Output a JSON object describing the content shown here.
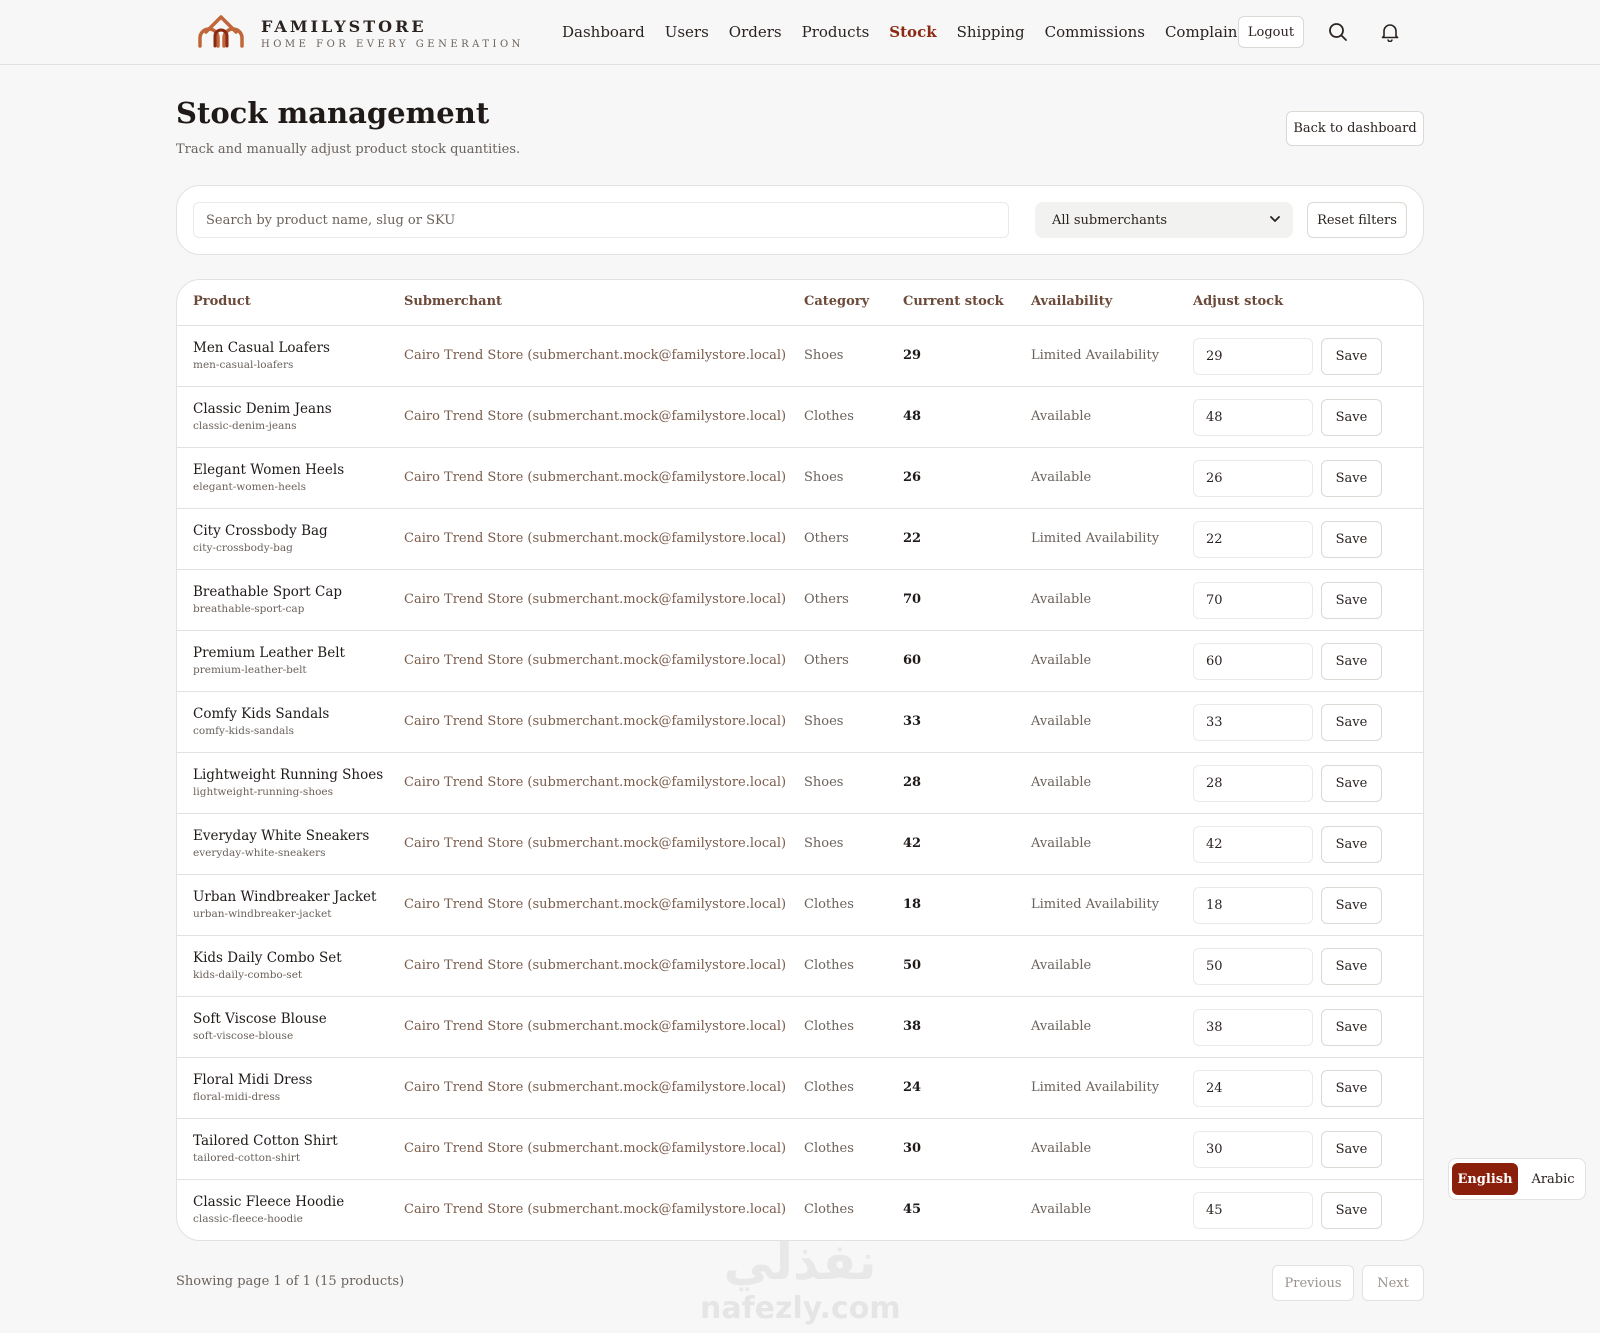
{
  "brand": {
    "name": "FAMILYSTORE",
    "tagline": "HOME FOR EVERY GENERATION"
  },
  "nav": {
    "items": [
      "Dashboard",
      "Users",
      "Orders",
      "Products",
      "Stock",
      "Shipping",
      "Commissions",
      "Complaints"
    ],
    "active": "Stock",
    "logout_label": "Logout"
  },
  "colors": {
    "accent": "#8a2a12",
    "lang_active_bg": "#8a1f0c"
  },
  "page": {
    "title": "Stock management",
    "subtitle": "Track and manually adjust product stock quantities.",
    "back_label": "Back to dashboard"
  },
  "filters": {
    "search_placeholder": "Search by product name, slug or SKU",
    "submerchant_selected": "All submerchants",
    "reset_label": "Reset filters"
  },
  "table": {
    "headers": [
      "Product",
      "Submerchant",
      "Category",
      "Current stock",
      "Availability",
      "Adjust stock"
    ],
    "save_label": "Save",
    "rows": [
      {
        "name": "Men Casual Loafers",
        "slug": "men-casual-loafers",
        "submerchant": "Cairo Trend Store (submerchant.mock@familystore.local)",
        "category": "Shoes",
        "stock": "29",
        "availability": "Limited Availability",
        "adjust": "29"
      },
      {
        "name": "Classic Denim Jeans",
        "slug": "classic-denim-jeans",
        "submerchant": "Cairo Trend Store (submerchant.mock@familystore.local)",
        "category": "Clothes",
        "stock": "48",
        "availability": "Available",
        "adjust": "48"
      },
      {
        "name": "Elegant Women Heels",
        "slug": "elegant-women-heels",
        "submerchant": "Cairo Trend Store (submerchant.mock@familystore.local)",
        "category": "Shoes",
        "stock": "26",
        "availability": "Available",
        "adjust": "26"
      },
      {
        "name": "City Crossbody Bag",
        "slug": "city-crossbody-bag",
        "submerchant": "Cairo Trend Store (submerchant.mock@familystore.local)",
        "category": "Others",
        "stock": "22",
        "availability": "Limited Availability",
        "adjust": "22"
      },
      {
        "name": "Breathable Sport Cap",
        "slug": "breathable-sport-cap",
        "submerchant": "Cairo Trend Store (submerchant.mock@familystore.local)",
        "category": "Others",
        "stock": "70",
        "availability": "Available",
        "adjust": "70"
      },
      {
        "name": "Premium Leather Belt",
        "slug": "premium-leather-belt",
        "submerchant": "Cairo Trend Store (submerchant.mock@familystore.local)",
        "category": "Others",
        "stock": "60",
        "availability": "Available",
        "adjust": "60"
      },
      {
        "name": "Comfy Kids Sandals",
        "slug": "comfy-kids-sandals",
        "submerchant": "Cairo Trend Store (submerchant.mock@familystore.local)",
        "category": "Shoes",
        "stock": "33",
        "availability": "Available",
        "adjust": "33"
      },
      {
        "name": "Lightweight Running Shoes",
        "slug": "lightweight-running-shoes",
        "submerchant": "Cairo Trend Store (submerchant.mock@familystore.local)",
        "category": "Shoes",
        "stock": "28",
        "availability": "Available",
        "adjust": "28"
      },
      {
        "name": "Everyday White Sneakers",
        "slug": "everyday-white-sneakers",
        "submerchant": "Cairo Trend Store (submerchant.mock@familystore.local)",
        "category": "Shoes",
        "stock": "42",
        "availability": "Available",
        "adjust": "42"
      },
      {
        "name": "Urban Windbreaker Jacket",
        "slug": "urban-windbreaker-jacket",
        "submerchant": "Cairo Trend Store (submerchant.mock@familystore.local)",
        "category": "Clothes",
        "stock": "18",
        "availability": "Limited Availability",
        "adjust": "18"
      },
      {
        "name": "Kids Daily Combo Set",
        "slug": "kids-daily-combo-set",
        "submerchant": "Cairo Trend Store (submerchant.mock@familystore.local)",
        "category": "Clothes",
        "stock": "50",
        "availability": "Available",
        "adjust": "50"
      },
      {
        "name": "Soft Viscose Blouse",
        "slug": "soft-viscose-blouse",
        "submerchant": "Cairo Trend Store (submerchant.mock@familystore.local)",
        "category": "Clothes",
        "stock": "38",
        "availability": "Available",
        "adjust": "38"
      },
      {
        "name": "Floral Midi Dress",
        "slug": "floral-midi-dress",
        "submerchant": "Cairo Trend Store (submerchant.mock@familystore.local)",
        "category": "Clothes",
        "stock": "24",
        "availability": "Limited Availability",
        "adjust": "24"
      },
      {
        "name": "Tailored Cotton Shirt",
        "slug": "tailored-cotton-shirt",
        "submerchant": "Cairo Trend Store (submerchant.mock@familystore.local)",
        "category": "Clothes",
        "stock": "30",
        "availability": "Available",
        "adjust": "30"
      },
      {
        "name": "Classic Fleece Hoodie",
        "slug": "classic-fleece-hoodie",
        "submerchant": "Cairo Trend Store (submerchant.mock@familystore.local)",
        "category": "Clothes",
        "stock": "45",
        "availability": "Available",
        "adjust": "45"
      }
    ]
  },
  "pagination": {
    "info": "Showing page 1 of 1 (15 products)",
    "prev_label": "Previous",
    "next_label": "Next"
  },
  "language": {
    "english_label": "English",
    "arabic_label": "Arabic",
    "active": "English"
  },
  "watermark": {
    "arabic": "نفذلي",
    "latin": "nafezly.com"
  }
}
